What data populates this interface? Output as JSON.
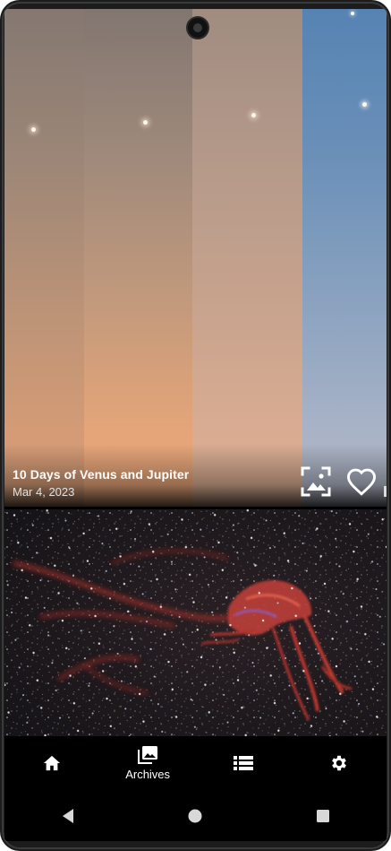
{
  "featured": {
    "title": "10 Days of Venus and Jupiter",
    "date": "Mar 4, 2023",
    "wallpaper_icon": "set-wallpaper-icon",
    "favorite_icon": "heart-outline-icon"
  },
  "second_image": {
    "icon": "nebula-photo"
  },
  "bottom_nav": {
    "items": [
      {
        "icon": "home-icon",
        "label": ""
      },
      {
        "icon": "archives-icon",
        "label": "Archives"
      },
      {
        "icon": "list-icon",
        "label": ""
      },
      {
        "icon": "settings-icon",
        "label": ""
      }
    ],
    "active_index": 1
  },
  "system_nav": {
    "back_icon": "back-icon",
    "home_icon": "home-circle-icon",
    "recents_icon": "recents-icon"
  },
  "colors": {
    "bar_background": "#000000",
    "icon_color": "#ffffff",
    "sky_blue": "#5683b3",
    "twilight_orange": "#e5a579"
  }
}
